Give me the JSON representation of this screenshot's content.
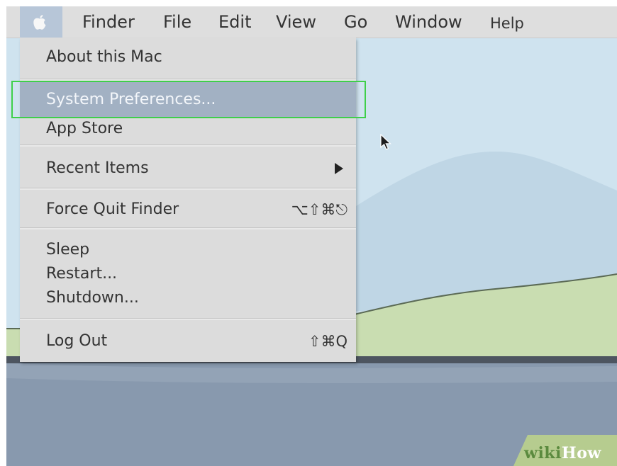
{
  "menubar": {
    "apple_icon": "apple-icon",
    "items": [
      {
        "label": "Finder"
      },
      {
        "label": "File"
      },
      {
        "label": "Edit"
      },
      {
        "label": "View"
      },
      {
        "label": "Go"
      },
      {
        "label": "Window"
      },
      {
        "label": "Help"
      }
    ]
  },
  "apple_menu": {
    "items": [
      {
        "label": "About this Mac"
      },
      {
        "label": "System Preferences...",
        "highlighted": true
      },
      {
        "label": "App Store"
      },
      {
        "label": "Recent Items",
        "submenu_icon": "submenu-arrow-icon"
      },
      {
        "label": "Force Quit Finder",
        "shortcut": "⌥⇧⌘⎋"
      },
      {
        "label": "Sleep"
      },
      {
        "label": "Restart..."
      },
      {
        "label": "Shutdown..."
      },
      {
        "label": "Log Out",
        "shortcut": "⇧⌘Q"
      }
    ]
  },
  "cursor": {
    "icon": "arrow-cursor-icon"
  },
  "watermark": {
    "part1": "wiki",
    "part2": "How"
  },
  "colors": {
    "menubar": "#dedede",
    "menu_background": "#dcdcdc",
    "menu_highlight": "#a2b1c3",
    "highlight_frame": "#3fcf4a",
    "sky": "#cfe3ef",
    "hills": "#c9ddb1",
    "water": "#8899ae"
  }
}
